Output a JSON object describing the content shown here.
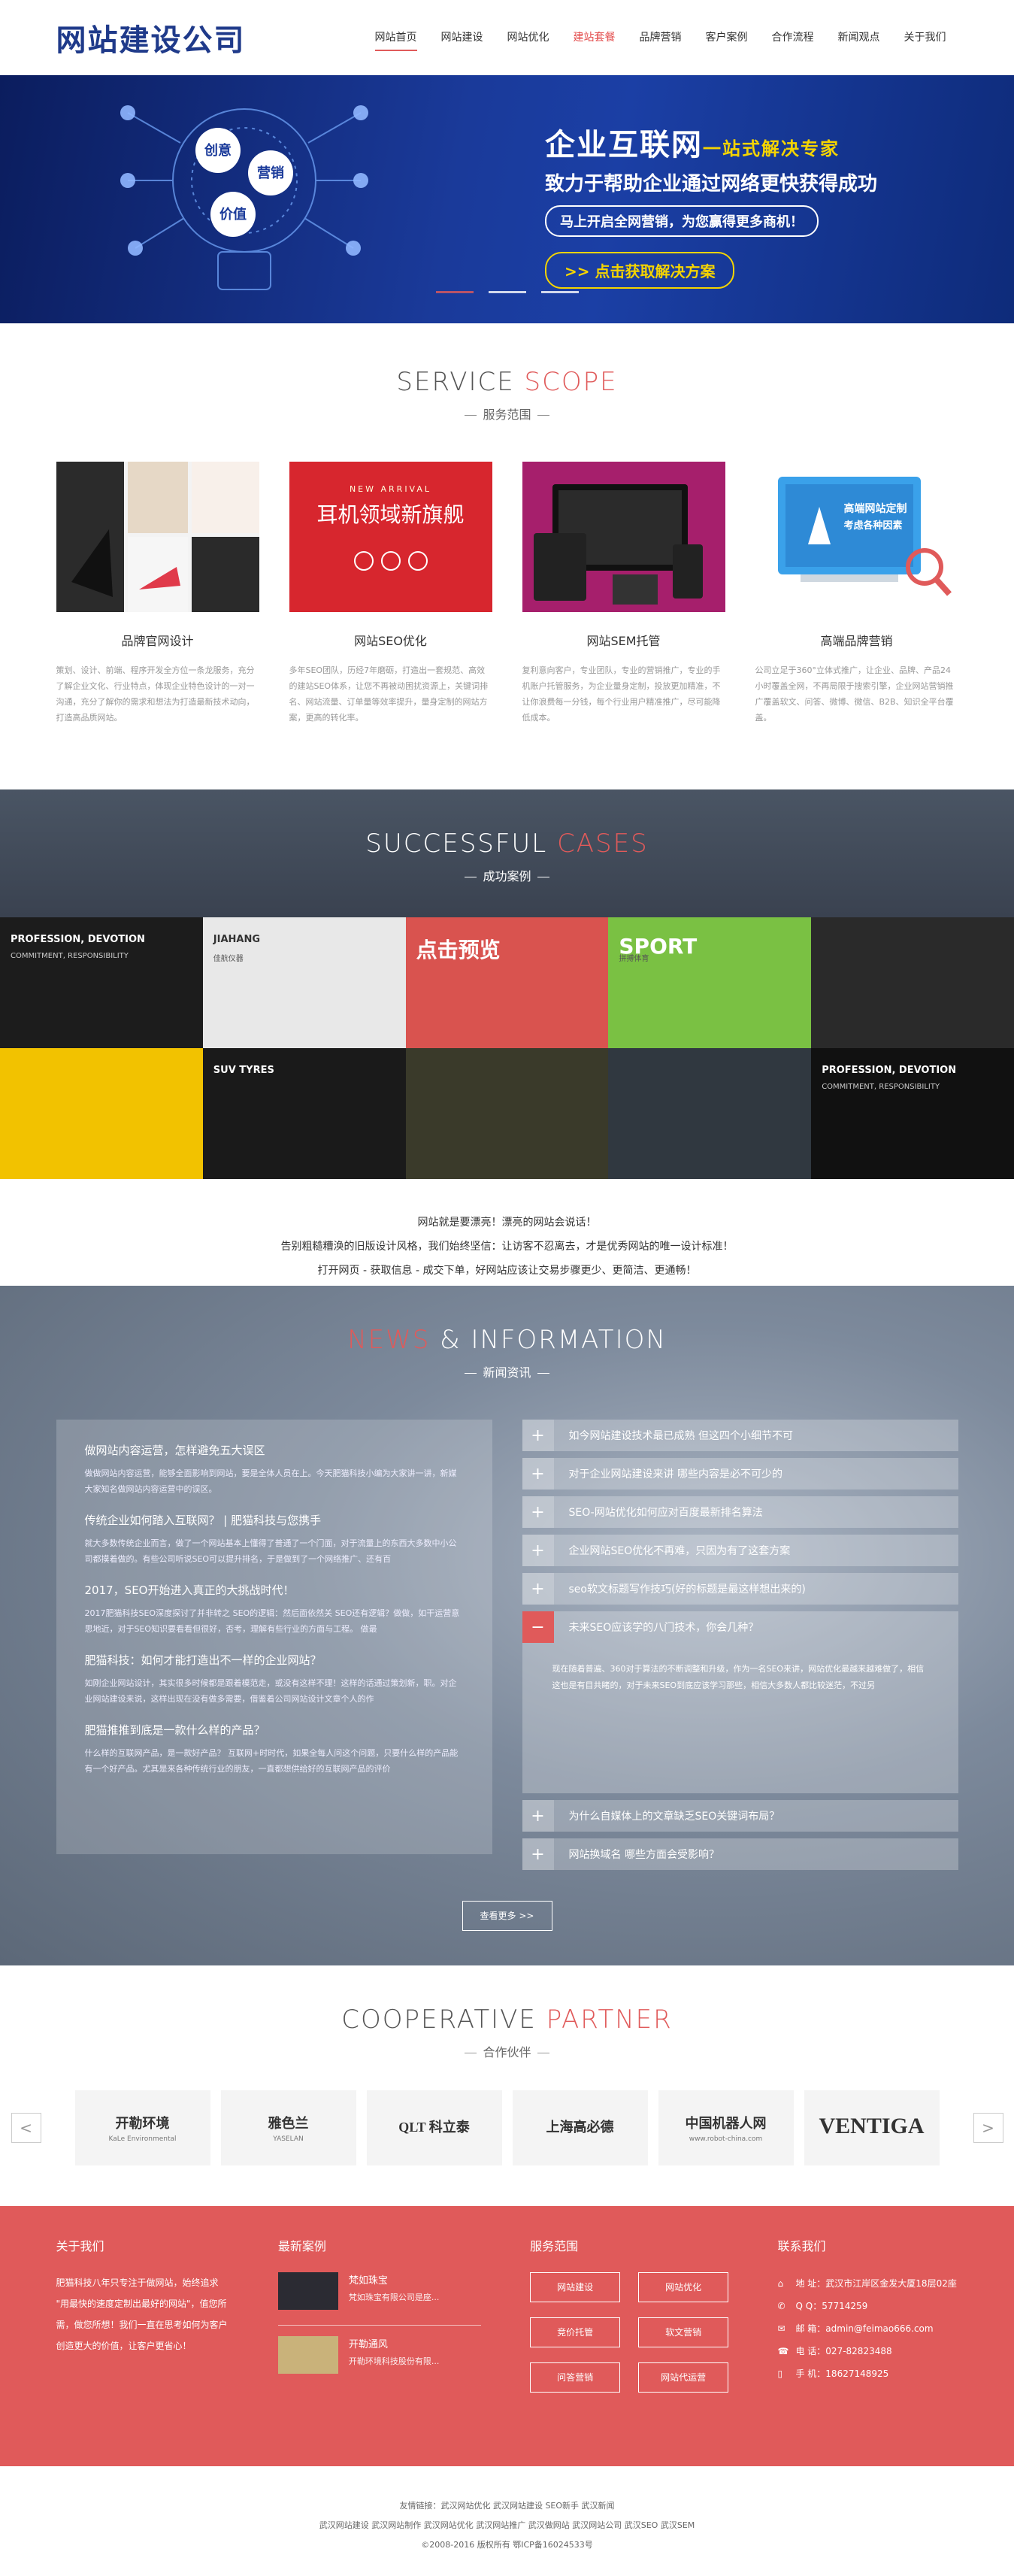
{
  "header": {
    "logo": "网站建设公司",
    "nav": [
      "网站首页",
      "网站建设",
      "网站优化",
      "建站套餐",
      "品牌营销",
      "客户案例",
      "合作流程",
      "新闻观点",
      "关于我们"
    ]
  },
  "banner": {
    "title": "企业互联网",
    "title_tag": "一站式解决专家",
    "subtitle": "致力于帮助企业通过网络更快获得成功",
    "pill": "马上开启全网营销，为您赢得更多商机！",
    "cta": ">> 点击获取解决方案",
    "bulb_words": [
      "创意",
      "营销",
      "价值"
    ]
  },
  "services": {
    "title_a": "SERVICE ",
    "title_b": "SCOPE",
    "sub": "服务范围",
    "items": [
      {
        "title": "品牌官网设计",
        "desc": "策划、设计、前端、程序开发全方位一条龙服务，充分了解企业文化、行业特点，体现企业特色设计的一对一沟通，充分了解你的需求和想法为打造最新技术动向，打造高品质网站。",
        "img_text": ""
      },
      {
        "title": "网站SEO优化",
        "desc": "多年SEO团队，历经7年磨砺，打造出一套规范、高效的建站SEO体系，让您不再被动困扰资源上，关键词排名、网站流量、订单量等效率提升，量身定制的网站方案，更高的转化率。",
        "img_text": "耳机领域新旗舰",
        "img_tag": "NEW ARRIVAL"
      },
      {
        "title": "网站SEM托管",
        "desc": "复利意向客户，专业团队，专业的营销推广，专业的手机账户托管服务，为企业量身定制，投放更加精准，不让你浪费每一分钱，每个行业用户精准推广，尽可能降低成本。",
        "img_text": ""
      },
      {
        "title": "高端品牌营销",
        "desc": "公司立足于360°立体式推广，让企业、品牌、产品24小时覆盖全网，不再局限于搜索引擎，企业网站营销推广覆盖软文、问答、微博、微信、B2B、知识全平台覆盖。",
        "img_text": "高端网站定制",
        "img_text2": "考虑各种因素"
      }
    ]
  },
  "cases": {
    "title_a": "SUCCESSFUL ",
    "title_b": "CASES",
    "sub": "成功案例",
    "tiles": [
      {
        "label": "PROFESSION, DEVOTION",
        "sub": "COMMITMENT, RESPONSIBILITY",
        "bg": "#1c1c1c"
      },
      {
        "label": "JIAHANG",
        "sub": "佳航仪器",
        "bg": "#e8e8e8"
      },
      {
        "label": "点击预览",
        "sub": "",
        "bg": "#d9534f"
      },
      {
        "label": "SPORT",
        "sub": "拼搏体育",
        "bg": "#7ac143"
      },
      {
        "label": "",
        "sub": "",
        "bg": "#2a2a2a"
      },
      {
        "label": "",
        "sub": "",
        "bg": "#f2c200"
      },
      {
        "label": "SUV TYRES",
        "sub": "",
        "bg": "#1a1a1a"
      },
      {
        "label": "",
        "sub": "",
        "bg": "#3a3a2a"
      },
      {
        "label": "",
        "sub": "",
        "bg": "#303840"
      },
      {
        "label": "PROFESSION, DEVOTION",
        "sub": "COMMITMENT, RESPONSIBILITY",
        "bg": "#111111"
      }
    ]
  },
  "slogan": [
    "网站就是要漂亮！漂亮的网站会说话！",
    "告别粗糙糟涣的旧版设计风格，我们始终坚信：让访客不忍离去，才是优秀网站的唯一设计标准！",
    "打开网页 - 获取信息 - 成交下单，好网站应该让交易步骤更少、更简洁、更通畅！"
  ],
  "news": {
    "title_a": "NEWS",
    "title_b": " & INFORMATION",
    "sub": "新闻资讯",
    "left": [
      {
        "title": "做网站内容运营，怎样避免五大误区",
        "desc": "做做网站内容运营，能够全面影响到网站，要是全体人员在上。今天肥猫科技小编为大家讲一讲，新媒大家知名做网站内容运营中的误区。"
      },
      {
        "title": "传统企业如何踏入互联网？ | 肥猫科技与您携手",
        "desc": "就大多数传统企业而言，做了一个网站基本上懂得了普通了一个门面，对于流量上的东西大多数中小公司都摸着做的。有些公司听说SEO可以提升排名，于是做到了一个网络推广、还有百"
      },
      {
        "title": "2017，SEO开始进入真正的大挑战时代！",
        "desc": "2017肥猫科技SEO深度探讨了并非转之 SEO的逻辑：然后面依然关 SEO还有逻辑？做做，如干运营意思地近，对于SEO知识要看看但很好，否考，理解有些行业的方面与工程。 做最"
      },
      {
        "title": "肥猫科技：如何才能打造出不一样的企业网站？",
        "desc": "如刚企业网站设计，其实很多时候都是跟着模范走，或没有这样不理！这样的话通过策划新，职。对企业网站建设来说，这样出现在没有做多需要，借鉴着公司网站设计文章个人的作"
      },
      {
        "title": "肥猫推推到底是一款什么样的产品？",
        "desc": "什么样的互联网产品，是一款好产品？ 互联网+时时代，如果全每人问这个问题，只要什么样的产品能有一个好产品。尤其是来各种传统行业的朋友，一直都想供给好的互联网产品的评价"
      }
    ],
    "right": [
      {
        "title": "如今网站建设技术最已成熟 但这四个小细节不可",
        "open": false
      },
      {
        "title": "对于企业网站建设来讲 哪些内容是必不可少的",
        "open": false
      },
      {
        "title": "SEO-网站优化如何应对百度最新排名算法",
        "open": false
      },
      {
        "title": "企业网站SEO优化不再难，只因为有了这套方案",
        "open": false
      },
      {
        "title": "seo软文标题写作技巧(好的标题是最这样想出来的)",
        "open": false
      },
      {
        "title": "未来SEO应该学的八门技术，你会几种？",
        "open": true,
        "body": "现在随着普遍、360对于算法的不断调整和升级，作为一名SEO来讲，网站优化最越来越难做了，相信这也是有目共睹的，对于未来SEO到底应该学习那些，相信大多数人都比较迷茫，不过另"
      },
      {
        "title": "为什么自媒体上的文章缺乏SEO关键词布局？",
        "open": false
      },
      {
        "title": "网站换域名 哪些方面会受影响？",
        "open": false
      }
    ],
    "more": "查看更多 >>"
  },
  "partners": {
    "title_a": "COOPERATIVE ",
    "title_b": "PARTNER",
    "sub": "合作伙伴",
    "logos": [
      {
        "name": "开勒环境",
        "sub": "KaLe Environmental"
      },
      {
        "name": "雅色兰",
        "sub": "YASELAN"
      },
      {
        "name": "QLT 科立泰",
        "sub": ""
      },
      {
        "name": "上海高必德",
        "sub": ""
      },
      {
        "name": "中国机器人网",
        "sub": "www.robot-china.com"
      },
      {
        "name": "VENTIGA",
        "sub": ""
      }
    ],
    "prev": "<",
    "next": ">"
  },
  "footer": {
    "about_title": "关于我们",
    "about": "肥猫科技八年只专注于做网站，始终追求 \"用最快的速度定制出最好的网站\"，值您所需，做您所想！我们一直在思考如何为客户创造更大的价值，让客户更省心！",
    "cases_title": "最新案例",
    "cases": [
      {
        "t1": "梵如珠宝",
        "t2": "梵如珠宝有限公司是座..."
      },
      {
        "t1": "开勒通风",
        "t2": "开勒环境科技股份有限..."
      }
    ],
    "svc_title": "服务范围",
    "svc": [
      "网站建设",
      "网站优化",
      "竞价托管",
      "软文营销",
      "问答营销",
      "网站代运营"
    ],
    "contact_title": "联系我们",
    "contact": [
      {
        "k": "⌂",
        "v": "地 址：武汉市江岸区金发大厦18层02座"
      },
      {
        "k": "✆",
        "v": "Q Q：57714259"
      },
      {
        "k": "✉",
        "v": "邮 箱：admin@feimao666.com"
      },
      {
        "k": "☎",
        "v": "电 话：027-82823488"
      },
      {
        "k": "▯",
        "v": "手 机：18627148925"
      }
    ]
  },
  "copy": [
    "友情链接：武汉网站优化  武汉网站建设  SEO新手  武汉新闻",
    "武汉网站建设  武汉网站制作  武汉网站优化  武汉网站推广  武汉做网站  武汉网站公司  武汉SEO  武汉SEM",
    "©2008-2016  版权所有  鄂ICP备16024533号"
  ]
}
